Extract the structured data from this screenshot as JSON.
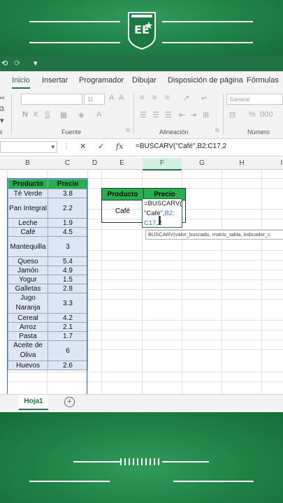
{
  "ribbon_tabs": [
    "Inicio",
    "Insertar",
    "Programador",
    "Dibujar",
    "Disposición de página",
    "Fórmulas"
  ],
  "ribbon_groups": [
    "Fuente",
    "Alineación",
    "Número"
  ],
  "ribbon_font_size": "11",
  "ribbon_number_format": "General",
  "formula_bar": {
    "fx": "fx",
    "formula": "=BUSCARV(\"Café\",B2:C17,2"
  },
  "columns": [
    "B",
    "C",
    "D",
    "E",
    "F",
    "G",
    "H",
    "I"
  ],
  "table": {
    "headers": [
      "Producto",
      "Precio"
    ],
    "rows": [
      [
        "Té Verde",
        "3.8"
      ],
      [
        "Pan Integral",
        "2.2"
      ],
      [
        "Leche",
        "1.9"
      ],
      [
        "Café",
        "4.5"
      ],
      [
        "Mantequilla",
        "3"
      ],
      [
        "Queso",
        "5.4"
      ],
      [
        "Jamón",
        "4.9"
      ],
      [
        "Yogur",
        "1.5"
      ],
      [
        "Galletas",
        "2.8"
      ],
      [
        "Jugo Naranja",
        "3.3"
      ],
      [
        "Cereal",
        "4.2"
      ],
      [
        "Arroz",
        "2.1"
      ],
      [
        "Pasta",
        "1.7"
      ],
      [
        "Aceite de Oliva",
        "6"
      ],
      [
        "Huevos",
        "2.6"
      ]
    ]
  },
  "lookup": {
    "headers": [
      "Producto",
      "Precio"
    ],
    "product": "Café",
    "editing": {
      "line1": "=BUSCARV(",
      "line2a": "\"Café\",",
      "line2b": "B2:",
      "line3a": "C17",
      "line3b": ",2"
    }
  },
  "tooltip": "BUSCARV(valor_buscado, matriz_tabla, indicador_c",
  "sheet_tab": "Hoja1",
  "add_sheet": "+"
}
